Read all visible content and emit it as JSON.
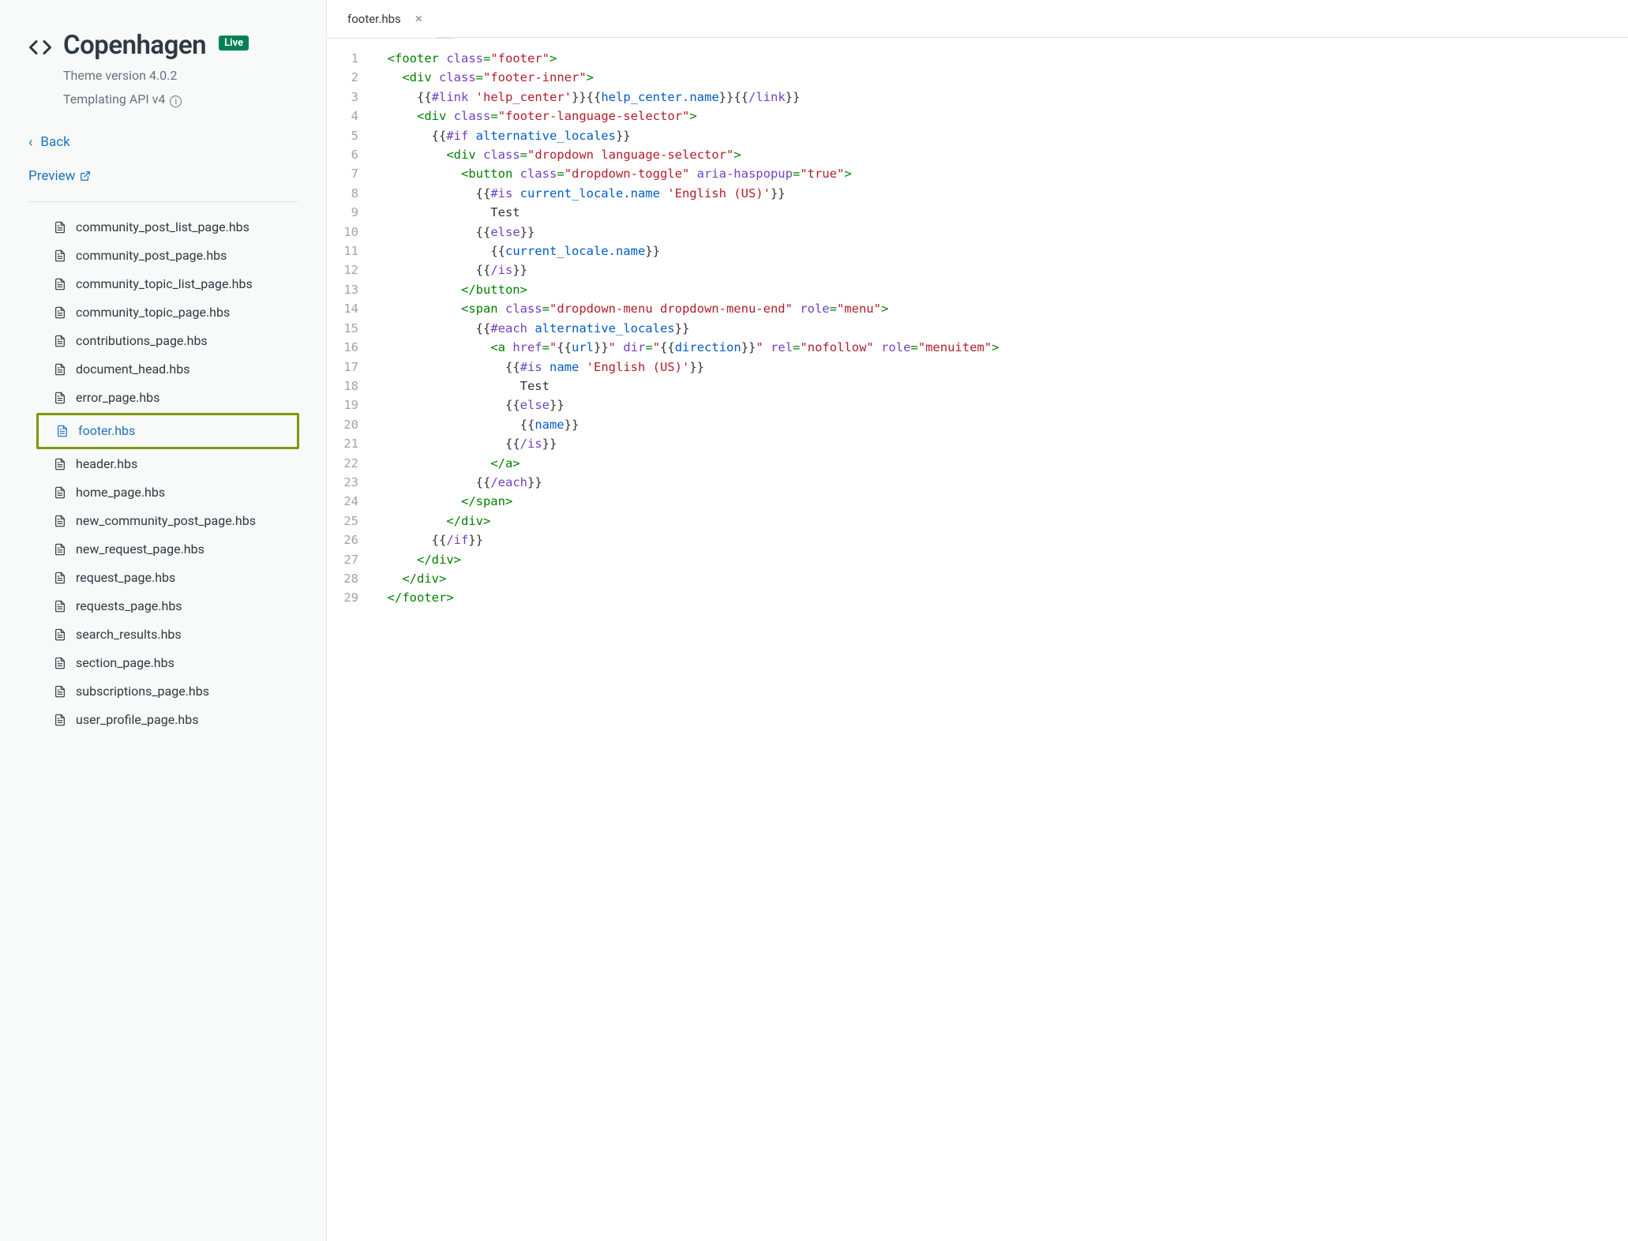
{
  "sidebar": {
    "theme_name": "Copenhagen",
    "live_badge": "Live",
    "version_label": "Theme version 4.0.2",
    "api_label": "Templating API v4",
    "back_label": "Back",
    "preview_label": "Preview",
    "files": [
      {
        "name": "community_post_list_page.hbs",
        "active": false
      },
      {
        "name": "community_post_page.hbs",
        "active": false
      },
      {
        "name": "community_topic_list_page.hbs",
        "active": false
      },
      {
        "name": "community_topic_page.hbs",
        "active": false
      },
      {
        "name": "contributions_page.hbs",
        "active": false
      },
      {
        "name": "document_head.hbs",
        "active": false
      },
      {
        "name": "error_page.hbs",
        "active": false
      },
      {
        "name": "footer.hbs",
        "active": true,
        "highlight": true
      },
      {
        "name": "header.hbs",
        "active": false
      },
      {
        "name": "home_page.hbs",
        "active": false
      },
      {
        "name": "new_community_post_page.hbs",
        "active": false
      },
      {
        "name": "new_request_page.hbs",
        "active": false
      },
      {
        "name": "request_page.hbs",
        "active": false
      },
      {
        "name": "requests_page.hbs",
        "active": false
      },
      {
        "name": "search_results.hbs",
        "active": false
      },
      {
        "name": "section_page.hbs",
        "active": false
      },
      {
        "name": "subscriptions_page.hbs",
        "active": false
      },
      {
        "name": "user_profile_page.hbs",
        "active": false
      }
    ]
  },
  "tabs": [
    {
      "label": "footer.hbs",
      "active": true
    }
  ],
  "code_lines": [
    {
      "n": 1,
      "tokens": [
        {
          "c": "  ",
          "k": "plain"
        },
        {
          "c": "<footer ",
          "k": "tag"
        },
        {
          "c": "class",
          "k": "attr"
        },
        {
          "c": "=",
          "k": "tag"
        },
        {
          "c": "\"footer\"",
          "k": "str"
        },
        {
          "c": ">",
          "k": "tag"
        }
      ]
    },
    {
      "n": 2,
      "tokens": [
        {
          "c": "    ",
          "k": "plain"
        },
        {
          "c": "<div ",
          "k": "tag"
        },
        {
          "c": "class",
          "k": "attr"
        },
        {
          "c": "=",
          "k": "tag"
        },
        {
          "c": "\"footer-inner\"",
          "k": "str"
        },
        {
          "c": ">",
          "k": "tag"
        }
      ]
    },
    {
      "n": 3,
      "tokens": [
        {
          "c": "      ",
          "k": "plain"
        },
        {
          "c": "{{",
          "k": "plain"
        },
        {
          "c": "#link ",
          "k": "hbkey"
        },
        {
          "c": "'help_center'",
          "k": "str"
        },
        {
          "c": "}}",
          "k": "plain"
        },
        {
          "c": "{{",
          "k": "plain"
        },
        {
          "c": "help_center.name",
          "k": "hbid"
        },
        {
          "c": "}}",
          "k": "plain"
        },
        {
          "c": "{{",
          "k": "plain"
        },
        {
          "c": "/link",
          "k": "hbkey"
        },
        {
          "c": "}}",
          "k": "plain"
        }
      ]
    },
    {
      "n": 4,
      "tokens": [
        {
          "c": "      ",
          "k": "plain"
        },
        {
          "c": "<div ",
          "k": "tag"
        },
        {
          "c": "class",
          "k": "attr"
        },
        {
          "c": "=",
          "k": "tag"
        },
        {
          "c": "\"footer-language-selector\"",
          "k": "str"
        },
        {
          "c": ">",
          "k": "tag"
        }
      ]
    },
    {
      "n": 5,
      "tokens": [
        {
          "c": "        ",
          "k": "plain"
        },
        {
          "c": "{{",
          "k": "plain"
        },
        {
          "c": "#if ",
          "k": "hbkey"
        },
        {
          "c": "alternative_locales",
          "k": "hbid"
        },
        {
          "c": "}}",
          "k": "plain"
        }
      ]
    },
    {
      "n": 6,
      "tokens": [
        {
          "c": "          ",
          "k": "plain"
        },
        {
          "c": "<div ",
          "k": "tag"
        },
        {
          "c": "class",
          "k": "attr"
        },
        {
          "c": "=",
          "k": "tag"
        },
        {
          "c": "\"dropdown language-selector\"",
          "k": "str"
        },
        {
          "c": ">",
          "k": "tag"
        }
      ]
    },
    {
      "n": 7,
      "tokens": [
        {
          "c": "            ",
          "k": "plain"
        },
        {
          "c": "<button ",
          "k": "tag"
        },
        {
          "c": "class",
          "k": "attr"
        },
        {
          "c": "=",
          "k": "tag"
        },
        {
          "c": "\"dropdown-toggle\"",
          "k": "str"
        },
        {
          "c": " ",
          "k": "tag"
        },
        {
          "c": "aria-haspopup",
          "k": "attr"
        },
        {
          "c": "=",
          "k": "tag"
        },
        {
          "c": "\"true\"",
          "k": "str"
        },
        {
          "c": ">",
          "k": "tag"
        }
      ]
    },
    {
      "n": 8,
      "tokens": [
        {
          "c": "              ",
          "k": "plain"
        },
        {
          "c": "{{",
          "k": "plain"
        },
        {
          "c": "#is ",
          "k": "hbkey"
        },
        {
          "c": "current_locale.name ",
          "k": "hbid"
        },
        {
          "c": "'English (US)'",
          "k": "str"
        },
        {
          "c": "}}",
          "k": "plain"
        }
      ]
    },
    {
      "n": 9,
      "tokens": [
        {
          "c": "                Test",
          "k": "plain"
        }
      ]
    },
    {
      "n": 10,
      "tokens": [
        {
          "c": "              ",
          "k": "plain"
        },
        {
          "c": "{{",
          "k": "plain"
        },
        {
          "c": "else",
          "k": "hbkey"
        },
        {
          "c": "}}",
          "k": "plain"
        }
      ]
    },
    {
      "n": 11,
      "tokens": [
        {
          "c": "                ",
          "k": "plain"
        },
        {
          "c": "{{",
          "k": "plain"
        },
        {
          "c": "current_locale.name",
          "k": "hbid"
        },
        {
          "c": "}}",
          "k": "plain"
        }
      ]
    },
    {
      "n": 12,
      "tokens": [
        {
          "c": "              ",
          "k": "plain"
        },
        {
          "c": "{{",
          "k": "plain"
        },
        {
          "c": "/is",
          "k": "hbkey"
        },
        {
          "c": "}}",
          "k": "plain"
        }
      ]
    },
    {
      "n": 13,
      "tokens": [
        {
          "c": "            ",
          "k": "plain"
        },
        {
          "c": "</button>",
          "k": "tag"
        }
      ]
    },
    {
      "n": 14,
      "tokens": [
        {
          "c": "            ",
          "k": "plain"
        },
        {
          "c": "<span ",
          "k": "tag"
        },
        {
          "c": "class",
          "k": "attr"
        },
        {
          "c": "=",
          "k": "tag"
        },
        {
          "c": "\"dropdown-menu dropdown-menu-end\"",
          "k": "str"
        },
        {
          "c": " ",
          "k": "tag"
        },
        {
          "c": "role",
          "k": "attr"
        },
        {
          "c": "=",
          "k": "tag"
        },
        {
          "c": "\"menu\"",
          "k": "str"
        },
        {
          "c": ">",
          "k": "tag"
        }
      ]
    },
    {
      "n": 15,
      "tokens": [
        {
          "c": "              ",
          "k": "plain"
        },
        {
          "c": "{{",
          "k": "plain"
        },
        {
          "c": "#each ",
          "k": "hbkey"
        },
        {
          "c": "alternative_locales",
          "k": "hbid"
        },
        {
          "c": "}}",
          "k": "plain"
        }
      ]
    },
    {
      "n": 16,
      "tokens": [
        {
          "c": "                ",
          "k": "plain"
        },
        {
          "c": "<a ",
          "k": "tag"
        },
        {
          "c": "href",
          "k": "attr"
        },
        {
          "c": "=",
          "k": "tag"
        },
        {
          "c": "\"",
          "k": "str"
        },
        {
          "c": "{{",
          "k": "plain"
        },
        {
          "c": "url",
          "k": "hbid"
        },
        {
          "c": "}}",
          "k": "plain"
        },
        {
          "c": "\"",
          "k": "str"
        },
        {
          "c": " ",
          "k": "tag"
        },
        {
          "c": "dir",
          "k": "attr"
        },
        {
          "c": "=",
          "k": "tag"
        },
        {
          "c": "\"",
          "k": "str"
        },
        {
          "c": "{{",
          "k": "plain"
        },
        {
          "c": "direction",
          "k": "hbid"
        },
        {
          "c": "}}",
          "k": "plain"
        },
        {
          "c": "\"",
          "k": "str"
        },
        {
          "c": " ",
          "k": "tag"
        },
        {
          "c": "rel",
          "k": "attr"
        },
        {
          "c": "=",
          "k": "tag"
        },
        {
          "c": "\"nofollow\"",
          "k": "str"
        },
        {
          "c": " ",
          "k": "tag"
        },
        {
          "c": "role",
          "k": "attr"
        },
        {
          "c": "=",
          "k": "tag"
        },
        {
          "c": "\"menuitem\"",
          "k": "str"
        },
        {
          "c": ">",
          "k": "tag"
        }
      ]
    },
    {
      "n": 17,
      "tokens": [
        {
          "c": "                  ",
          "k": "plain"
        },
        {
          "c": "{{",
          "k": "plain"
        },
        {
          "c": "#is ",
          "k": "hbkey"
        },
        {
          "c": "name ",
          "k": "hbid"
        },
        {
          "c": "'English (US)'",
          "k": "str"
        },
        {
          "c": "}}",
          "k": "plain"
        }
      ]
    },
    {
      "n": 18,
      "tokens": [
        {
          "c": "                    Test",
          "k": "plain"
        }
      ]
    },
    {
      "n": 19,
      "tokens": [
        {
          "c": "                  ",
          "k": "plain"
        },
        {
          "c": "{{",
          "k": "plain"
        },
        {
          "c": "else",
          "k": "hbkey"
        },
        {
          "c": "}}",
          "k": "plain"
        }
      ]
    },
    {
      "n": 20,
      "tokens": [
        {
          "c": "                    ",
          "k": "plain"
        },
        {
          "c": "{{",
          "k": "plain"
        },
        {
          "c": "name",
          "k": "hbid"
        },
        {
          "c": "}}",
          "k": "plain"
        }
      ]
    },
    {
      "n": 21,
      "tokens": [
        {
          "c": "                  ",
          "k": "plain"
        },
        {
          "c": "{{",
          "k": "plain"
        },
        {
          "c": "/is",
          "k": "hbkey"
        },
        {
          "c": "}}",
          "k": "plain"
        }
      ]
    },
    {
      "n": 22,
      "tokens": [
        {
          "c": "                ",
          "k": "plain"
        },
        {
          "c": "</a>",
          "k": "tag"
        }
      ]
    },
    {
      "n": 23,
      "tokens": [
        {
          "c": "              ",
          "k": "plain"
        },
        {
          "c": "{{",
          "k": "plain"
        },
        {
          "c": "/each",
          "k": "hbkey"
        },
        {
          "c": "}}",
          "k": "plain"
        }
      ]
    },
    {
      "n": 24,
      "tokens": [
        {
          "c": "            ",
          "k": "plain"
        },
        {
          "c": "</span>",
          "k": "tag"
        }
      ]
    },
    {
      "n": 25,
      "tokens": [
        {
          "c": "          ",
          "k": "plain"
        },
        {
          "c": "</div>",
          "k": "tag"
        }
      ]
    },
    {
      "n": 26,
      "tokens": [
        {
          "c": "        ",
          "k": "plain"
        },
        {
          "c": "{{",
          "k": "plain"
        },
        {
          "c": "/if",
          "k": "hbkey"
        },
        {
          "c": "}}",
          "k": "plain"
        }
      ]
    },
    {
      "n": 27,
      "tokens": [
        {
          "c": "      ",
          "k": "plain"
        },
        {
          "c": "</div>",
          "k": "tag"
        }
      ]
    },
    {
      "n": 28,
      "tokens": [
        {
          "c": "    ",
          "k": "plain"
        },
        {
          "c": "</div>",
          "k": "tag"
        }
      ]
    },
    {
      "n": 29,
      "tokens": [
        {
          "c": "  ",
          "k": "plain"
        },
        {
          "c": "</footer>",
          "k": "tag"
        }
      ]
    }
  ]
}
